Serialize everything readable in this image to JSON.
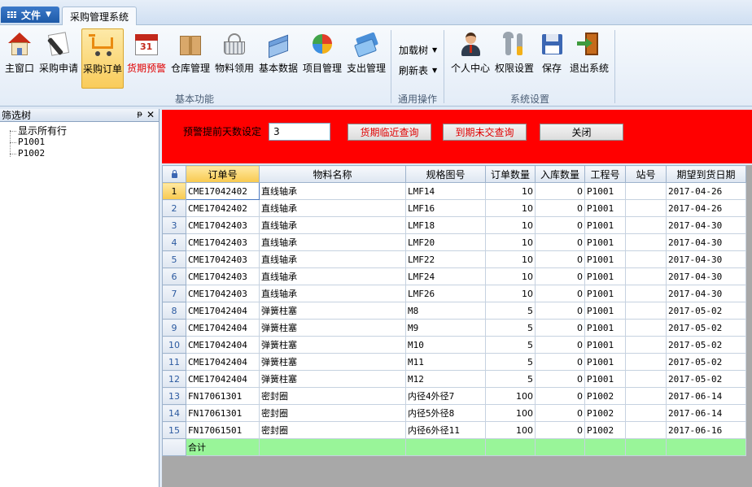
{
  "topbar": {
    "file_label": "文件",
    "active_tab": "采购管理系统"
  },
  "ribbon": {
    "buttons": [
      {
        "label": "主窗口",
        "icon": "house-icon"
      },
      {
        "label": "采购申请",
        "icon": "pen-icon"
      },
      {
        "label": "采购订单",
        "icon": "cart-icon"
      },
      {
        "label": "货期预警",
        "icon": "calendar-icon"
      },
      {
        "label": "仓库管理",
        "icon": "box-icon"
      },
      {
        "label": "物料领用",
        "icon": "basket-icon"
      },
      {
        "label": "基本数据",
        "icon": "books-icon"
      },
      {
        "label": "项目管理",
        "icon": "pie-chart-icon"
      },
      {
        "label": "支出管理",
        "icon": "payment-icon"
      }
    ],
    "group_basic": "基本功能",
    "load_tree": "加载树",
    "refresh_table": "刷新表",
    "group_common": "通用操作",
    "settings": [
      {
        "label": "个人中心",
        "icon": "user-icon"
      },
      {
        "label": "权限设置",
        "icon": "wrench-icon"
      },
      {
        "label": "保存",
        "icon": "floppy-icon"
      },
      {
        "label": "退出系统",
        "icon": "exit-icon"
      }
    ],
    "group_settings": "系统设置"
  },
  "left_pane": {
    "title": "筛选树",
    "pin": "ᵽ",
    "close": "✕",
    "items": [
      "显示所有行",
      "P1001",
      "P1002"
    ]
  },
  "filter": {
    "days_label": "预警提前天数设定",
    "days_value": "3",
    "btn_near": "货期临近查询",
    "btn_overdue": "到期未交查询",
    "btn_close": "关闭"
  },
  "grid": {
    "columns": [
      "订单号",
      "物料名称",
      "规格图号",
      "订单数量",
      "入库数量",
      "工程号",
      "站号",
      "期望到货日期"
    ],
    "rows": [
      [
        "CME17042402",
        "直线轴承",
        "LMF14",
        "10",
        "0",
        "P1001",
        "",
        "2017-04-26"
      ],
      [
        "CME17042402",
        "直线轴承",
        "LMF16",
        "10",
        "0",
        "P1001",
        "",
        "2017-04-26"
      ],
      [
        "CME17042403",
        "直线轴承",
        "LMF18",
        "10",
        "0",
        "P1001",
        "",
        "2017-04-30"
      ],
      [
        "CME17042403",
        "直线轴承",
        "LMF20",
        "10",
        "0",
        "P1001",
        "",
        "2017-04-30"
      ],
      [
        "CME17042403",
        "直线轴承",
        "LMF22",
        "10",
        "0",
        "P1001",
        "",
        "2017-04-30"
      ],
      [
        "CME17042403",
        "直线轴承",
        "LMF24",
        "10",
        "0",
        "P1001",
        "",
        "2017-04-30"
      ],
      [
        "CME17042403",
        "直线轴承",
        "LMF26",
        "10",
        "0",
        "P1001",
        "",
        "2017-04-30"
      ],
      [
        "CME17042404",
        "弹簧柱塞",
        "M8",
        "5",
        "0",
        "P1001",
        "",
        "2017-05-02"
      ],
      [
        "CME17042404",
        "弹簧柱塞",
        "M9",
        "5",
        "0",
        "P1001",
        "",
        "2017-05-02"
      ],
      [
        "CME17042404",
        "弹簧柱塞",
        "M10",
        "5",
        "0",
        "P1001",
        "",
        "2017-05-02"
      ],
      [
        "CME17042404",
        "弹簧柱塞",
        "M11",
        "5",
        "0",
        "P1001",
        "",
        "2017-05-02"
      ],
      [
        "CME17042404",
        "弹簧柱塞",
        "M12",
        "5",
        "0",
        "P1001",
        "",
        "2017-05-02"
      ],
      [
        "FN17061301",
        "密封圈",
        "内径4外径7",
        "100",
        "0",
        "P1002",
        "",
        "2017-06-14"
      ],
      [
        "FN17061301",
        "密封圈",
        "内径5外径8",
        "100",
        "0",
        "P1002",
        "",
        "2017-06-14"
      ],
      [
        "FN17061501",
        "密封圈",
        "内径6外径11",
        "100",
        "0",
        "P1002",
        "",
        "2017-06-16"
      ]
    ],
    "total_label": "合计"
  }
}
